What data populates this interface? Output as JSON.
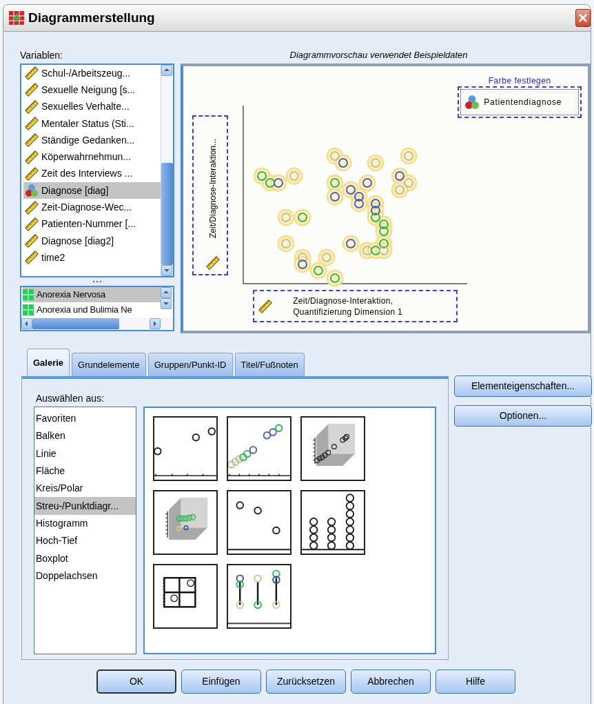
{
  "window": {
    "title": "Diagrammerstellung"
  },
  "variables": {
    "label": "Variablen:",
    "items": [
      {
        "name": "Schul-/Arbeitszeug...",
        "kind": "scale",
        "selected": false
      },
      {
        "name": "Sexuelle Neigung [s...",
        "kind": "scale",
        "selected": false
      },
      {
        "name": "Sexuelles Verhalte...",
        "kind": "scale",
        "selected": false
      },
      {
        "name": "Mentaler Status (Sti...",
        "kind": "scale",
        "selected": false
      },
      {
        "name": "Ständige Gedanken...",
        "kind": "scale",
        "selected": false
      },
      {
        "name": "Köperwahrnehmun...",
        "kind": "scale",
        "selected": false
      },
      {
        "name": "Zeit des Interviews ...",
        "kind": "scale",
        "selected": false
      },
      {
        "name": "Diagnose [diag]",
        "kind": "nominal",
        "selected": true
      },
      {
        "name": "Zeit-Diagnose-Wec...",
        "kind": "scale",
        "selected": false
      },
      {
        "name": "Patienten-Nummer [...",
        "kind": "scale",
        "selected": false
      },
      {
        "name": "Diagnose [diag2]",
        "kind": "scale",
        "selected": false
      },
      {
        "name": "time2",
        "kind": "scale",
        "selected": false
      }
    ]
  },
  "categories": [
    {
      "name": "Anorexia Nervosa",
      "selected": true
    },
    {
      "name": "Anorexia und Bulimia Ne",
      "selected": false
    }
  ],
  "preview": {
    "caption": "Diagrammvorschau verwendet Beispieldaten",
    "y_axis": {
      "label": "Zeit/Diagnose-Interaktion..."
    },
    "x_axis": {
      "label": "Zeit/Diagnose-Interaktion,\nQuantifizierung Dimension 1"
    },
    "color_zone": {
      "title": "Farbe festlegen",
      "label": "Patientendiagnose"
    }
  },
  "tabs": [
    {
      "label": "Galerie",
      "selected": true
    },
    {
      "label": "Grundelemente",
      "selected": false
    },
    {
      "label": "Gruppen/Punkt-ID",
      "selected": false
    },
    {
      "label": "Titel/Fußnoten",
      "selected": false
    }
  ],
  "gallery": {
    "label": "Auswählen aus:",
    "chart_types": [
      {
        "name": "Favoriten",
        "selected": false
      },
      {
        "name": "Balken",
        "selected": false
      },
      {
        "name": "Linie",
        "selected": false
      },
      {
        "name": "Fläche",
        "selected": false
      },
      {
        "name": "Kreis/Polar",
        "selected": false
      },
      {
        "name": "Streu-/Punktdiagr...",
        "selected": true
      },
      {
        "name": "Histogramm",
        "selected": false
      },
      {
        "name": "Hoch-Tief",
        "selected": false
      },
      {
        "name": "Boxplot",
        "selected": false
      },
      {
        "name": "Doppelachsen",
        "selected": false
      }
    ]
  },
  "side_buttons": [
    "Elementeigenschaften...",
    "Optionen..."
  ],
  "buttons": [
    {
      "label": "OK",
      "default": true
    },
    {
      "label": "Einfügen",
      "default": false
    },
    {
      "label": "Zurücksetzen",
      "default": false
    },
    {
      "label": "Abbrechen",
      "default": false
    },
    {
      "label": "Hilfe",
      "default": false
    }
  ]
}
